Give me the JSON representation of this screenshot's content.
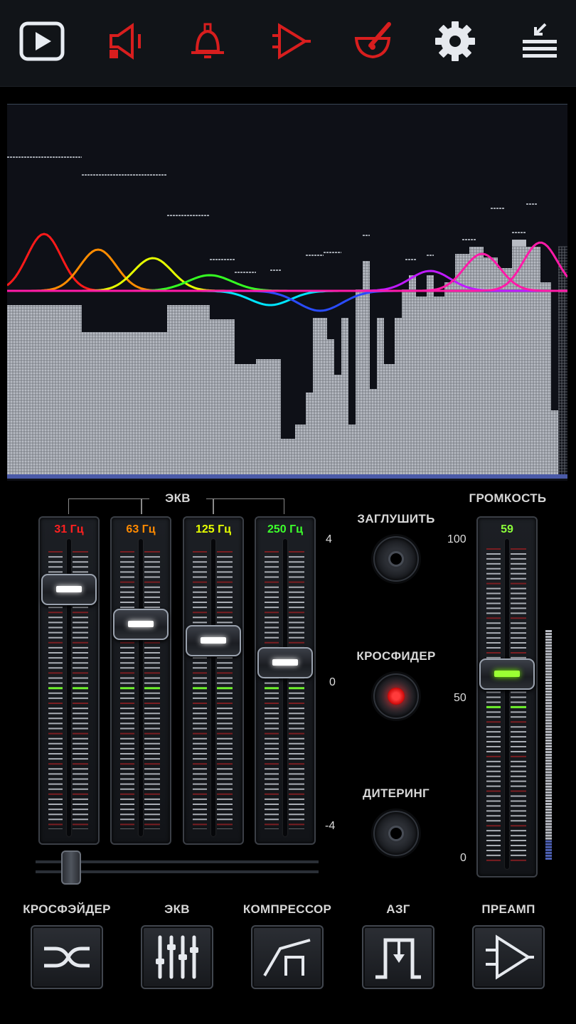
{
  "toolbar": {
    "buttons": [
      {
        "name": "player",
        "icon": "play-icon"
      },
      {
        "name": "speaker",
        "icon": "speaker-muted-icon"
      },
      {
        "name": "bell",
        "icon": "bell-icon"
      },
      {
        "name": "amplifier",
        "icon": "amplifier-icon"
      },
      {
        "name": "mortar",
        "icon": "mortar-icon"
      },
      {
        "name": "settings",
        "icon": "gear-icon"
      },
      {
        "name": "menu",
        "icon": "collapse-menu-icon"
      }
    ]
  },
  "colors": {
    "accent_red": "#d81e1e",
    "eq_red": "#ff2020",
    "eq_orange": "#ff8a00",
    "eq_yellow": "#e6ff00",
    "eq_green": "#3dff2c",
    "volume_green": "#8cff3a"
  },
  "analyzer": {
    "curve_colors": [
      "#ff1a1a",
      "#ff8c00",
      "#e6ff00",
      "#35ff22",
      "#00e5ff",
      "#2a4cff",
      "#c01aff",
      "#ff1aa8"
    ]
  },
  "eq": {
    "title": "ЭКВ",
    "bands": [
      {
        "label": "31 Гц",
        "color": "#ff2020",
        "level": 3.1
      },
      {
        "label": "63 Гц",
        "color": "#ff8a00",
        "level": 2.0
      },
      {
        "label": "125 Гц",
        "color": "#e6ff00",
        "level": 1.5
      },
      {
        "label": "250 Гц",
        "color": "#3dff2c",
        "level": 0.8
      }
    ],
    "scale": {
      "top": "4",
      "mid": "0",
      "bottom": "-4"
    },
    "balance_position": 0.09
  },
  "controls": {
    "mute_label": "ЗАГЛУШИТЬ",
    "crossfader_label": "КРОСФИДЕР",
    "crossfader_on": true,
    "dither_label": "ДИТЕРИНГ"
  },
  "volume": {
    "title": "ГРОМКОСТЬ",
    "value": "59",
    "level": 59,
    "scale": {
      "top": "100",
      "mid": "50",
      "bottom": "0"
    }
  },
  "bottom_tabs": [
    {
      "label": "КРОСФЭЙДЕР",
      "icon": "crossfade-icon"
    },
    {
      "label": "ЭКВ",
      "icon": "equalizer-sliders-icon"
    },
    {
      "label": "КОМПРЕССОР",
      "icon": "compressor-icon"
    },
    {
      "label": "АЗГ",
      "icon": "noise-gate-icon"
    },
    {
      "label": "ПРЕАМП",
      "icon": "preamp-icon"
    }
  ]
}
